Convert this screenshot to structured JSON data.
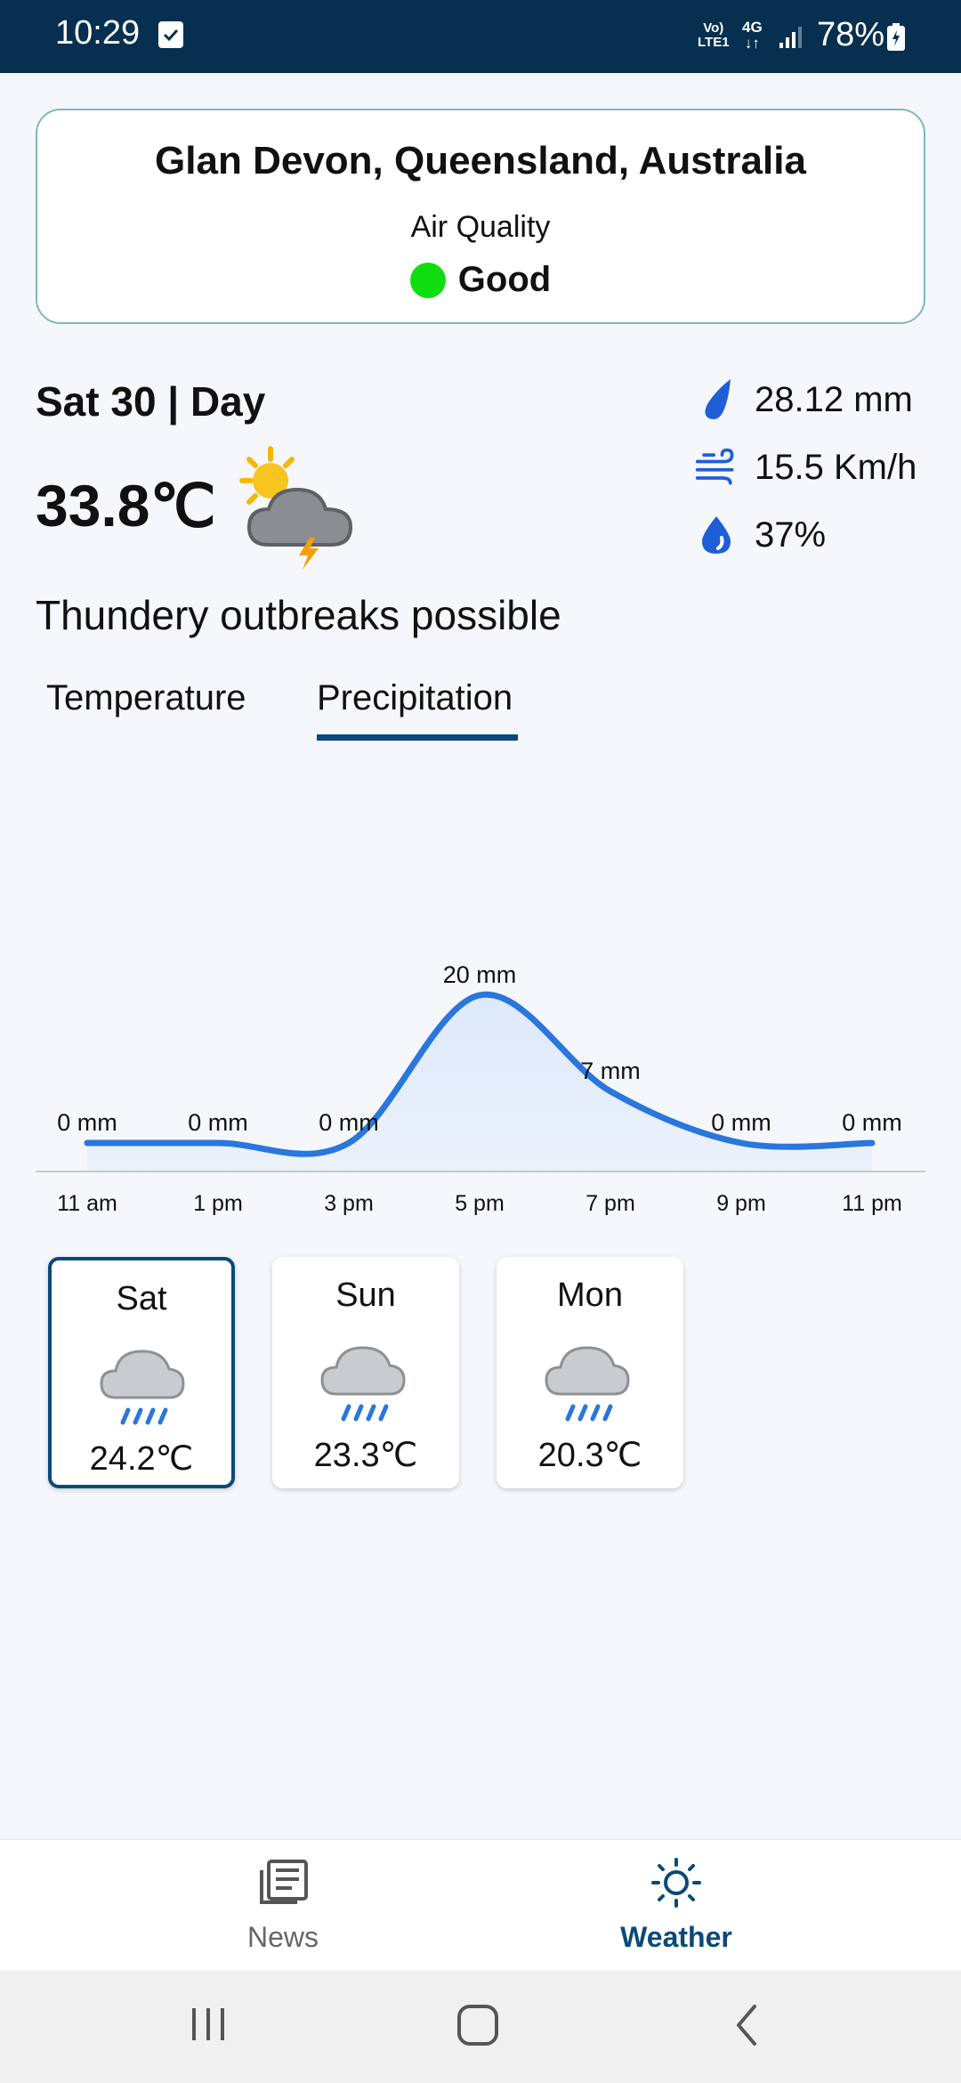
{
  "status_bar": {
    "time": "10:29",
    "network_top": "Vo)",
    "network_bottom": "LTE1",
    "net_type": "4G",
    "battery": "78%"
  },
  "air_quality": {
    "location": "Glan Devon, Queensland, Australia",
    "label": "Air Quality",
    "status": "Good",
    "status_color": "#10dd10"
  },
  "current": {
    "day": "Sat 30 | Day",
    "temperature": "33.8℃",
    "condition": "Thundery outbreaks possible",
    "icon": "sun-cloud-thunder-icon",
    "precipitation": "28.12 mm",
    "wind": "15.5 Km/h",
    "humidity": "37%"
  },
  "tabs": {
    "temperature": "Temperature",
    "precipitation": "Precipitation",
    "active": "Precipitation"
  },
  "chart_data": {
    "type": "area",
    "categories": [
      "11 am",
      "1 pm",
      "3 pm",
      "5 pm",
      "7 pm",
      "9 pm",
      "11 pm"
    ],
    "values": [
      0,
      0,
      0,
      20,
      7,
      0,
      0
    ],
    "data_labels": [
      "0 mm",
      "0 mm",
      "0 mm",
      "20 mm",
      "7 mm",
      "0 mm",
      "0 mm"
    ],
    "title": "",
    "xlabel": "",
    "ylabel": "",
    "line_color": "#2a76dd",
    "fill_color": "#dde9fa"
  },
  "forecast": [
    {
      "day": "Sat",
      "temp": "24.2℃",
      "icon": "cloud-rain-icon",
      "selected": true
    },
    {
      "day": "Sun",
      "temp": "23.3℃",
      "icon": "cloud-rain-icon",
      "selected": false
    },
    {
      "day": "Mon",
      "temp": "20.3℃",
      "icon": "cloud-rain-icon",
      "selected": false
    }
  ],
  "bottom_nav": {
    "news": "News",
    "weather": "Weather",
    "active": "Weather"
  },
  "colors": {
    "accent": "#0a4a78",
    "status_bar": "#073050"
  }
}
